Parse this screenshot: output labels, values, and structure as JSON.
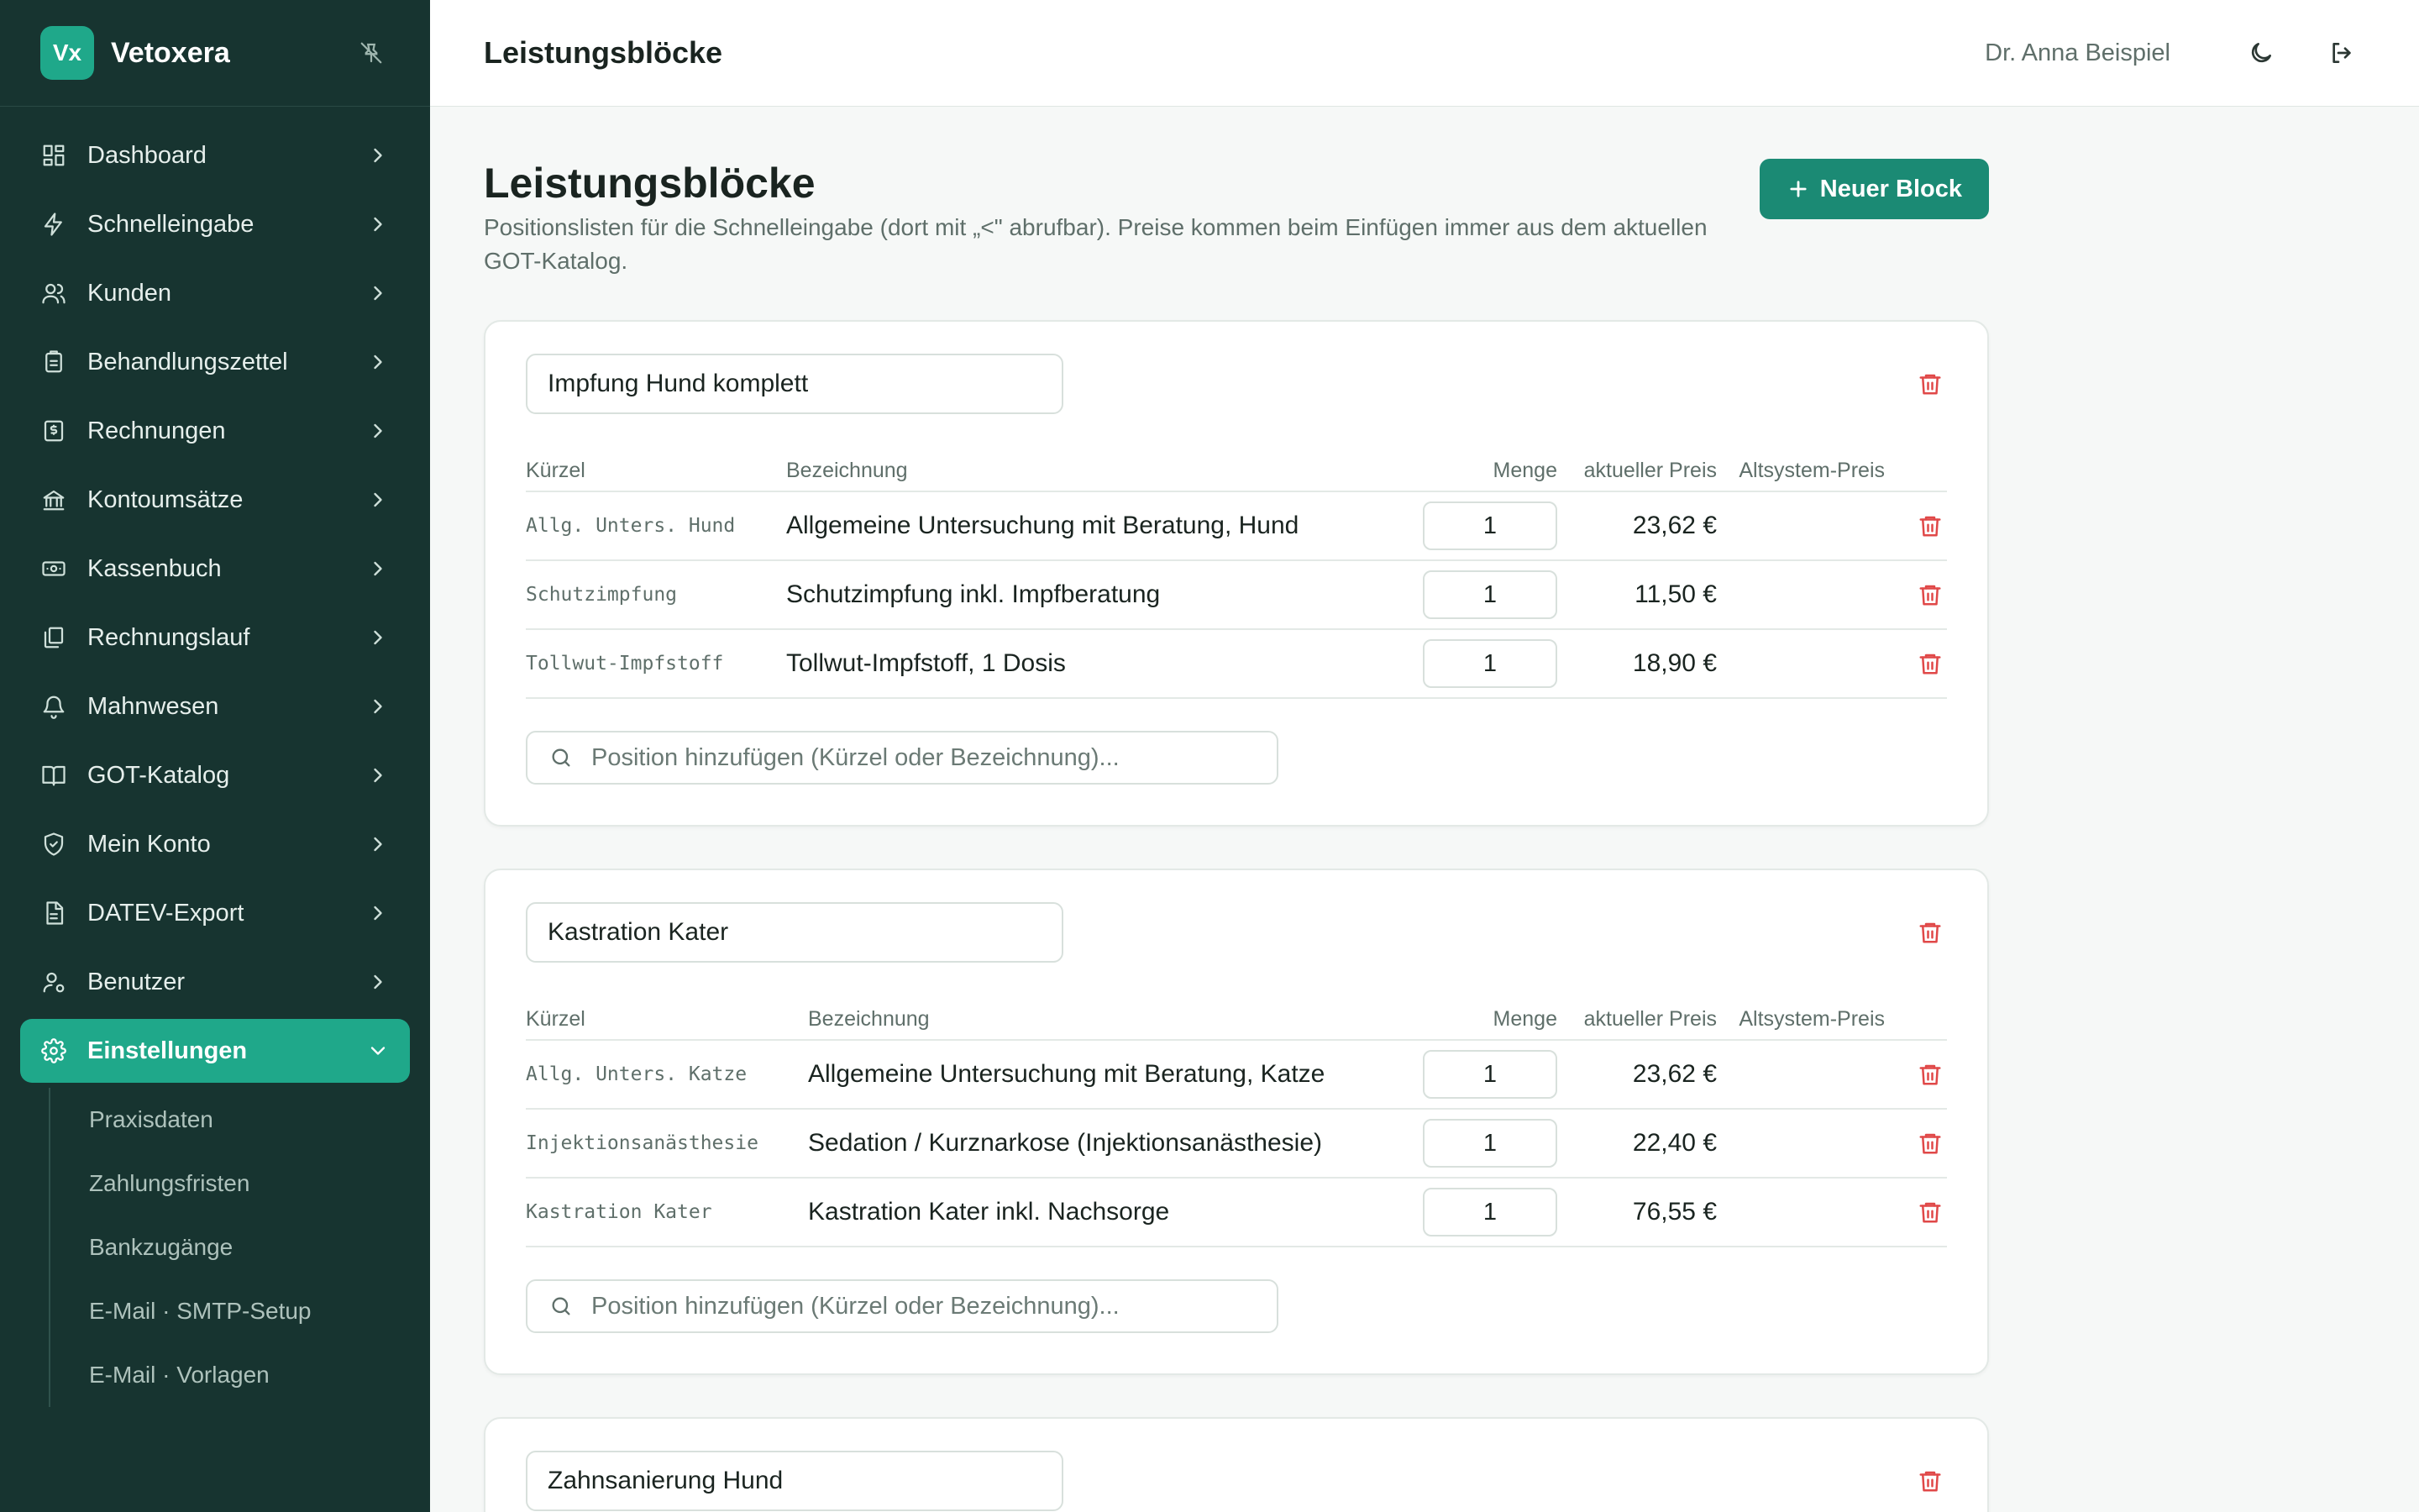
{
  "brand": {
    "logo": "Vx",
    "name": "Vetoxera"
  },
  "sidebar": {
    "items": [
      {
        "label": "Dashboard",
        "icon": "dashboard-icon"
      },
      {
        "label": "Schnelleingabe",
        "icon": "lightning-icon"
      },
      {
        "label": "Kunden",
        "icon": "users-icon"
      },
      {
        "label": "Behandlungszettel",
        "icon": "clipboard-icon"
      },
      {
        "label": "Rechnungen",
        "icon": "invoice-icon"
      },
      {
        "label": "Kontoumsätze",
        "icon": "bank-icon"
      },
      {
        "label": "Kassenbuch",
        "icon": "cash-icon"
      },
      {
        "label": "Rechnungslauf",
        "icon": "copies-icon"
      },
      {
        "label": "Mahnwesen",
        "icon": "bell-icon"
      },
      {
        "label": "GOT-Katalog",
        "icon": "book-icon"
      },
      {
        "label": "Mein Konto",
        "icon": "shield-icon"
      },
      {
        "label": "DATEV-Export",
        "icon": "document-icon"
      },
      {
        "label": "Benutzer",
        "icon": "user-cog-icon"
      },
      {
        "label": "Einstellungen",
        "icon": "gear-icon",
        "active": true
      }
    ],
    "subitems": [
      "Praxisdaten",
      "Zahlungsfristen",
      "Bankzugänge",
      "E-Mail · SMTP-Setup",
      "E-Mail · Vorlagen"
    ]
  },
  "topbar": {
    "title": "Leistungsblöcke",
    "user": "Dr. Anna Beispiel"
  },
  "page": {
    "title": "Leistungsblöcke",
    "description": "Positionslisten für die Schnelleingabe (dort mit „<\" abrufbar). Preise kommen beim Einfügen immer aus dem aktuellen GOT-Katalog.",
    "new_button": "Neuer Block"
  },
  "table_headers": {
    "code": "Kürzel",
    "name": "Bezeichnung",
    "qty": "Menge",
    "price": "aktueller Preis",
    "old_price": "Altsystem-Preis"
  },
  "search_placeholder": "Position hinzufügen (Kürzel oder Bezeichnung)...",
  "blocks": [
    {
      "name": "Impfung Hund komplett",
      "rows": [
        {
          "code": "Allg. Unters. Hund",
          "name": "Allgemeine Untersuchung mit Beratung, Hund",
          "qty": "1",
          "price": "23,62 €",
          "old_price": ""
        },
        {
          "code": "Schutzimpfung",
          "name": "Schutzimpfung inkl. Impfberatung",
          "qty": "1",
          "price": "11,50 €",
          "old_price": ""
        },
        {
          "code": "Tollwut-Impfstoff",
          "name": "Tollwut-Impfstoff, 1 Dosis",
          "qty": "1",
          "price": "18,90 €",
          "old_price": ""
        }
      ]
    },
    {
      "name": "Kastration Kater",
      "rows": [
        {
          "code": "Allg. Unters. Katze",
          "name": "Allgemeine Untersuchung mit Beratung, Katze",
          "qty": "1",
          "price": "23,62 €",
          "old_price": ""
        },
        {
          "code": "Injektionsanästhesie",
          "name": "Sedation / Kurznarkose (Injektionsanästhesie)",
          "qty": "1",
          "price": "22,40 €",
          "old_price": ""
        },
        {
          "code": "Kastration Kater",
          "name": "Kastration Kater inkl. Nachsorge",
          "qty": "1",
          "price": "76,55 €",
          "old_price": ""
        }
      ]
    },
    {
      "name": "Zahnsanierung Hund",
      "rows": []
    }
  ],
  "colors": {
    "sidebar_bg": "#173430",
    "accent": "#1fa88a",
    "primary_button": "#1b8a74",
    "danger": "#e04848"
  }
}
